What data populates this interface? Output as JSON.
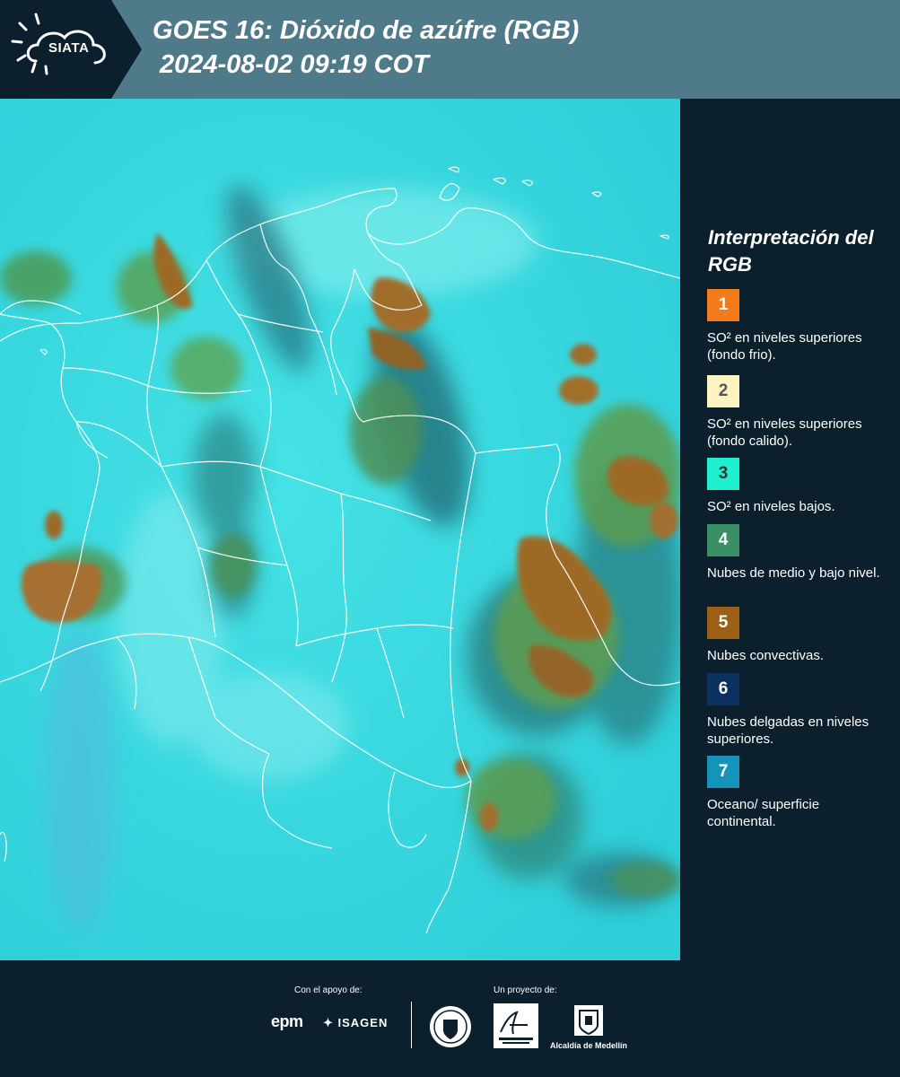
{
  "header": {
    "logo_text": "SIATA",
    "title": "GOES 16: Dióxido de azúfre (RGB)",
    "subtitle": "2024-08-02 09:19 COT"
  },
  "legend": {
    "title": "Interpretación del RGB",
    "items": [
      {
        "number": "1",
        "color": "#f47b1c",
        "text_color": "#ffffff",
        "label": "SO² en niveles superiores (fondo frio)."
      },
      {
        "number": "2",
        "color": "#fdf4c2",
        "text_color": "#555555",
        "label": "SO² en niveles superiores (fondo calido)."
      },
      {
        "number": "3",
        "color": "#1ef0cf",
        "text_color": "#333333",
        "label": "SO² en niveles bajos."
      },
      {
        "number": "4",
        "color": "#3a8f64",
        "text_color": "#ffffff",
        "label": "Nubes de medio y bajo nivel."
      },
      {
        "number": "5",
        "color": "#9c5f16",
        "text_color": "#ffffff",
        "label": "Nubes convectivas."
      },
      {
        "number": "6",
        "color": "#0c3060",
        "text_color": "#ffffff",
        "label": "Nubes delgadas en niveles superiores."
      },
      {
        "number": "7",
        "color": "#1593b8",
        "text_color": "#ffffff",
        "label": "Oceano/ superficie continental."
      }
    ]
  },
  "footer": {
    "support_label": "Con el apoyo de:",
    "project_label": "Un proyecto de:",
    "sponsor_1": "epm",
    "sponsor_2": "ISAGEN",
    "partner_1": "Área Metropolitana Valle de Aburrá",
    "partner_2": "Alcaldía de Medellín"
  },
  "colors": {
    "header_bg": "#4f7a8a",
    "panel_bg": "#0c1f2c",
    "map_base": "#33d6de",
    "cloud_convective": "#9c6a26",
    "cloud_low": "#4d9a5a"
  }
}
